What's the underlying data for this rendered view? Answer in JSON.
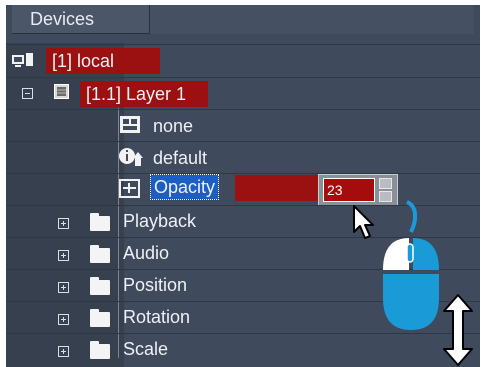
{
  "panel": {
    "title": "Devices"
  },
  "tree": {
    "device": {
      "label": "[1] local"
    },
    "layer": {
      "label": "[1.1] Layer 1"
    },
    "items": [
      {
        "label": "none"
      },
      {
        "label": "default"
      },
      {
        "label": "Opacity"
      }
    ],
    "folders": [
      {
        "label": "Playback"
      },
      {
        "label": "Audio"
      },
      {
        "label": "Position"
      },
      {
        "label": "Rotation"
      },
      {
        "label": "Scale"
      }
    ]
  },
  "editor": {
    "value": "23"
  },
  "colors": {
    "selection": "#9b1010",
    "mouse": "#1a9bd7",
    "panel": "#3f4a5c"
  }
}
